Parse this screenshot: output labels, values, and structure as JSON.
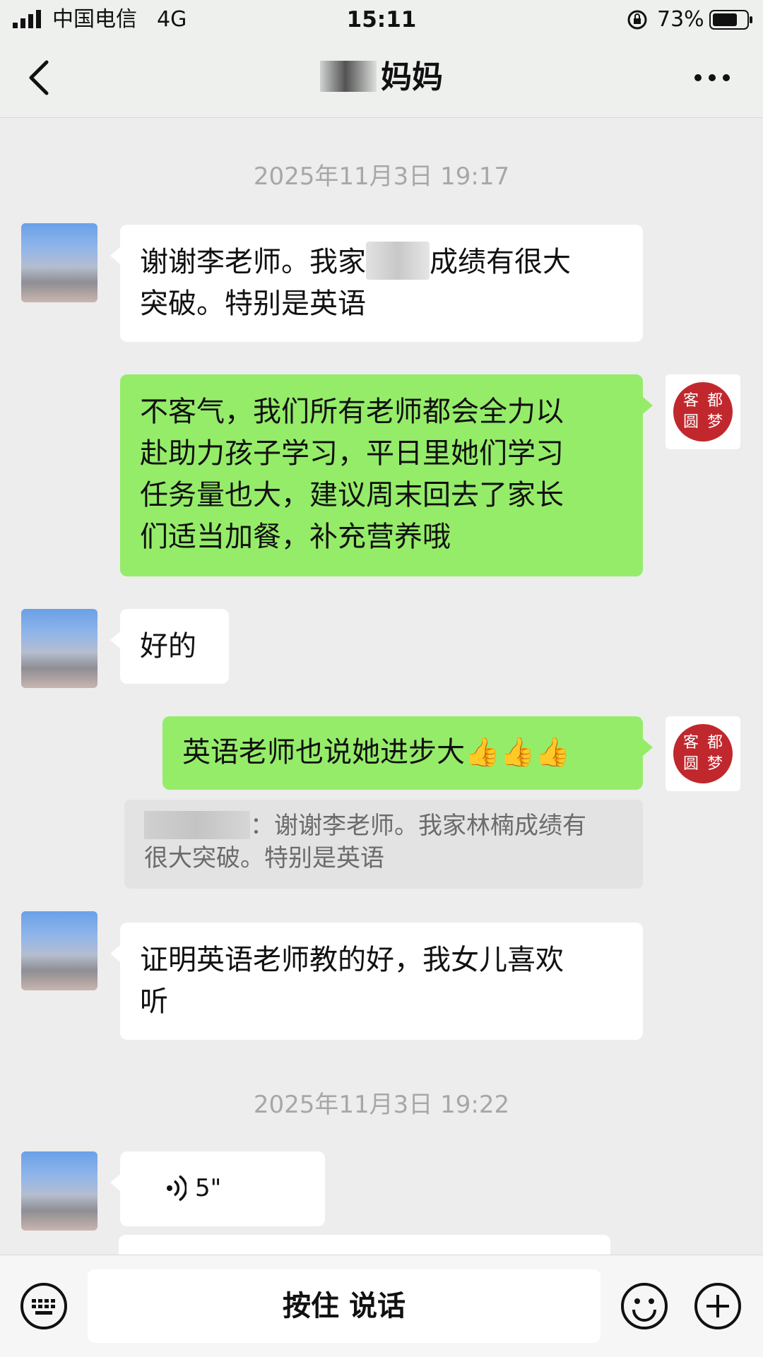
{
  "status_bar": {
    "carrier": "中国电信",
    "network": "4G",
    "time": "15:11",
    "battery_percent": "73%",
    "battery_level": 0.73,
    "icons": [
      "signal-icon",
      "orientation-lock-icon",
      "battery-icon"
    ]
  },
  "nav": {
    "title": "妈妈",
    "back_icon": "chevron-left-icon",
    "more_icon": "more-dots-icon"
  },
  "messages": [
    {
      "type": "timestamp",
      "text": "2025年11月3日 19:17"
    },
    {
      "type": "text",
      "from": "parent",
      "line1a": "谢谢李老师。我家",
      "line1b": "成绩有很大",
      "line2": "突破。特别是英语"
    },
    {
      "type": "text",
      "from": "teacher",
      "lines": [
        "不客气，我们所有老师都会全力以",
        "赴助力孩子学习，平日里她们学习",
        "任务量也大，建议周末回去了家长",
        "们适当加餐，补充营养哦"
      ]
    },
    {
      "type": "text",
      "from": "parent",
      "text": "好的"
    },
    {
      "type": "text",
      "from": "teacher",
      "text": "英语老师也说她进步大",
      "emoji": "👍👍👍"
    },
    {
      "type": "quote",
      "separator": "：",
      "line1": "谢谢李老师。我家林楠成绩有",
      "line2": "很大突破。特别是英语"
    },
    {
      "type": "text",
      "from": "parent",
      "lines": [
        "证明英语老师教的好，我女儿喜欢",
        "听"
      ]
    },
    {
      "type": "timestamp",
      "text": "2025年11月3日 19:22"
    },
    {
      "type": "voice",
      "from": "parent",
      "duration": "5\""
    }
  ],
  "teacher_avatar": {
    "chars": [
      "客",
      "都",
      "圆",
      "梦"
    ],
    "color": "#c0282d"
  },
  "input_bar": {
    "hold_to_talk": "按住 说话",
    "keyboard_icon": "keyboard-icon",
    "emoji_icon": "smiley-icon",
    "plus_icon": "plus-circle-icon"
  },
  "colors": {
    "background": "#ededed",
    "sent_bubble": "#95ec69",
    "received_bubble": "#ffffff",
    "timestamp": "#a7a7a7"
  }
}
